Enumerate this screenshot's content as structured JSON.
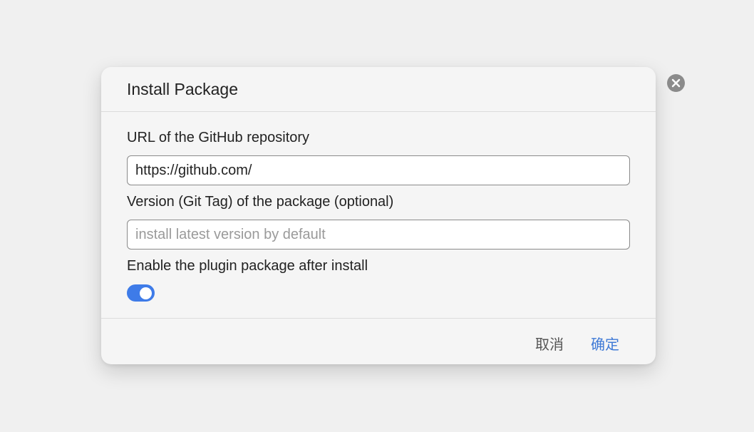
{
  "dialog": {
    "title": "Install Package",
    "url_field": {
      "label": "URL of the GitHub repository",
      "value": "https://github.com/"
    },
    "version_field": {
      "label": "Version (Git Tag) of the package (optional)",
      "value": "",
      "placeholder": "install latest version by default"
    },
    "enable_toggle": {
      "label": "Enable the plugin package after install",
      "checked": true
    },
    "cancel_label": "取消",
    "confirm_label": "确定"
  },
  "icons": {
    "close": "close-icon"
  },
  "colors": {
    "accent": "#3e7be8",
    "confirm_text": "#3f7ad6",
    "close_button": "#8b8b8b"
  }
}
